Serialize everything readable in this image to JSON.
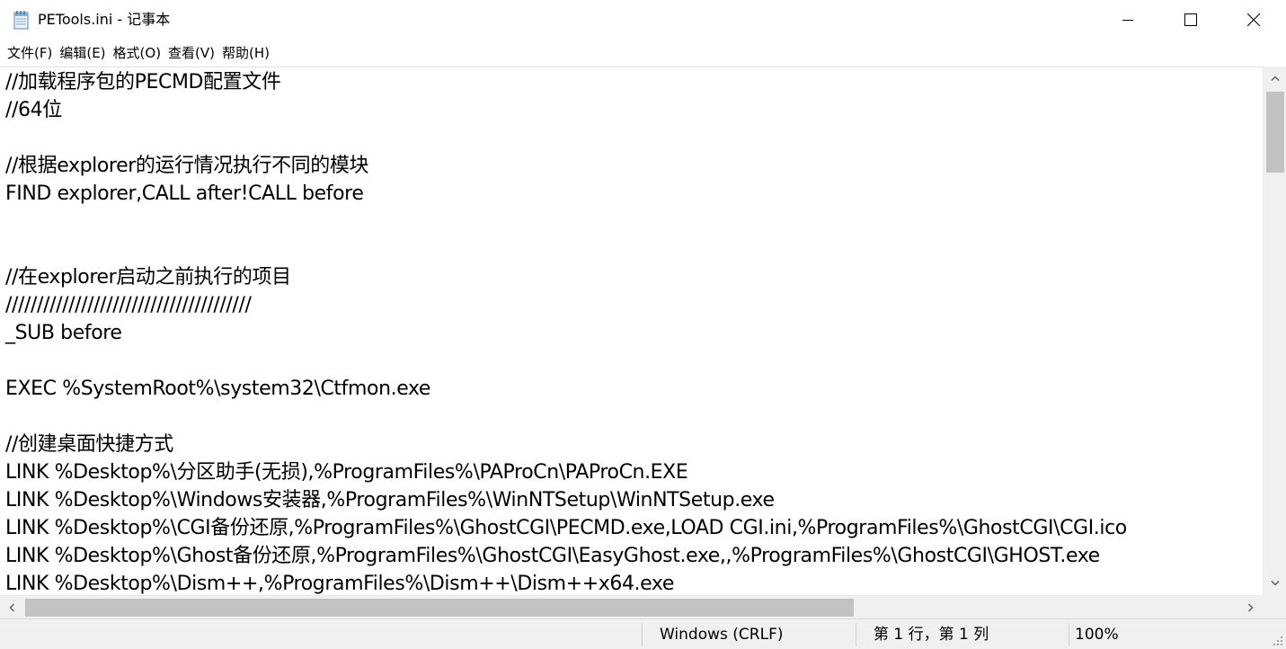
{
  "window": {
    "title": "PETools.ini - 记事本",
    "icon": "notepad-icon"
  },
  "menu": [
    {
      "label": "文件(F)"
    },
    {
      "label": "编辑(E)"
    },
    {
      "label": "格式(O)"
    },
    {
      "label": "查看(V)"
    },
    {
      "label": "帮助(H)"
    }
  ],
  "content": {
    "lines": [
      "//加载程序包的PECMD配置文件",
      "//64位",
      "",
      "//根据explorer的运行情况执行不同的模块",
      "FIND explorer,CALL after!CALL before",
      "",
      "",
      "//在explorer启动之前执行的项目",
      "///////////////////////////////////////",
      "_SUB before",
      "",
      "EXEC %SystemRoot%\\system32\\Ctfmon.exe",
      "",
      "//创建桌面快捷方式",
      "LINK %Desktop%\\分区助手(无损),%ProgramFiles%\\PAProCn\\PAProCn.EXE",
      "LINK %Desktop%\\Windows安装器,%ProgramFiles%\\WinNTSetup\\WinNTSetup.exe",
      "LINK %Desktop%\\CGI备份还原,%ProgramFiles%\\GhostCGI\\PECMD.exe,LOAD CGI.ini,%ProgramFiles%\\GhostCGI\\CGI.ico",
      "LINK %Desktop%\\Ghost备份还原,%ProgramFiles%\\GhostCGI\\EasyGhost.exe,,%ProgramFiles%\\GhostCGI\\GHOST.exe",
      "LINK %Desktop%\\Dism++,%ProgramFiles%\\Dism++\\Dism++x64.exe"
    ]
  },
  "status": {
    "line_ending": "Windows (CRLF)",
    "position": "第 1 行，第 1 列",
    "zoom": "100%"
  }
}
